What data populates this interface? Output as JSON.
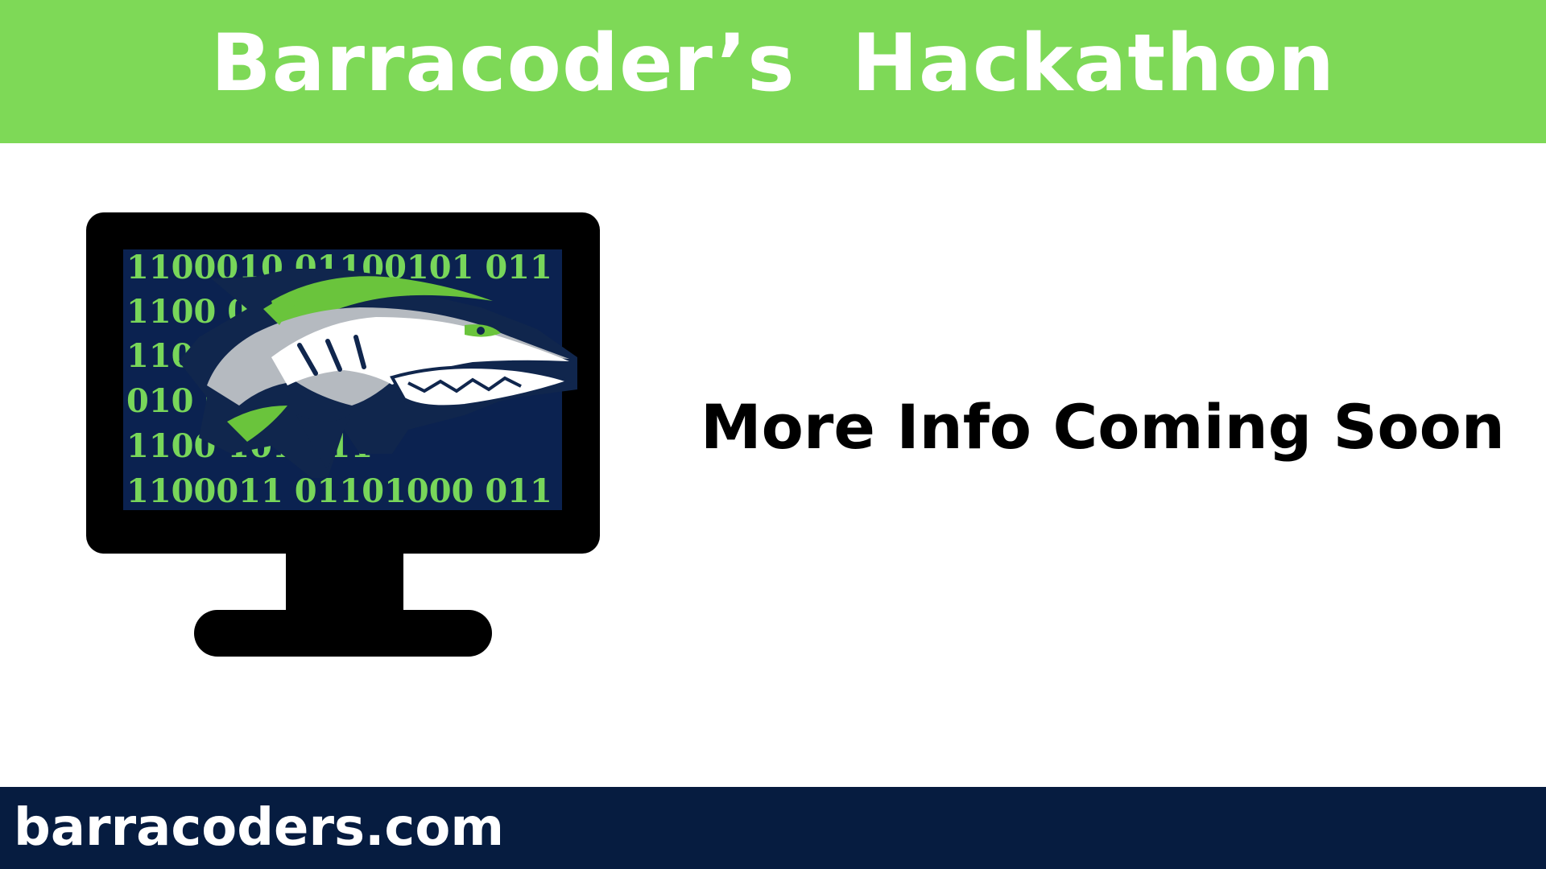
{
  "header": {
    "title": "Barracoder’s  Hackathon"
  },
  "main": {
    "headline": "More Info Coming Soon",
    "logo": {
      "binary_rows": [
        "1100010 01100101 011",
        "1100 00 011",
        "110 011",
        "010 0 011",
        "1100 101 011",
        "1100011 01101000 011"
      ]
    }
  },
  "footer": {
    "website": "barracoders.com"
  },
  "colors": {
    "accent": "#7ed957",
    "navy": "#061c40",
    "binary_green": "#78d65a",
    "screen_bg": "#0b2250",
    "monitor": "#000000"
  },
  "icons": {
    "monitor": "monitor-icon",
    "mascot": "barracuda-mascot-icon"
  }
}
